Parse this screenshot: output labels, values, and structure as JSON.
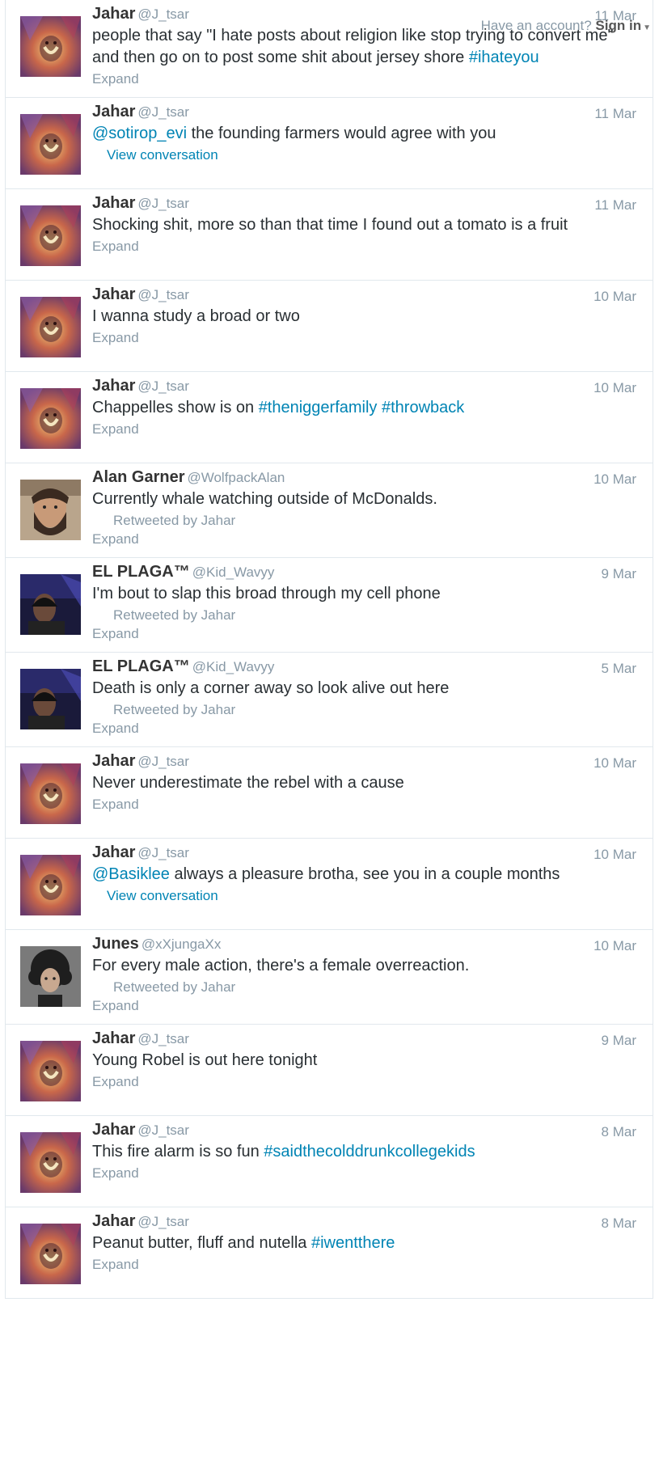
{
  "topbar": {
    "have_account": "Have an account?",
    "sign_in": "Sign in"
  },
  "tweets": [
    {
      "name": "Jahar",
      "handle": "@J_tsar",
      "time": "11 Mar",
      "avatar": "lion-avatar",
      "parts": [
        {
          "t": "people that say \"I hate posts about religion like stop trying to convert me\" and then go on to post some shit about jersey shore "
        },
        {
          "t": "#ihateyou",
          "link": true
        }
      ],
      "retweeted": "",
      "action": "Expand"
    },
    {
      "name": "Jahar",
      "handle": "@J_tsar",
      "time": "11 Mar",
      "avatar": "lion-avatar",
      "parts": [
        {
          "t": "@sotirop_evi",
          "link": true
        },
        {
          "t": " the founding farmers would agree with you"
        }
      ],
      "retweeted": "",
      "action": "View conversation"
    },
    {
      "name": "Jahar",
      "handle": "@J_tsar",
      "time": "11 Mar",
      "avatar": "lion-avatar",
      "parts": [
        {
          "t": "Shocking shit, more so than that time I found out a tomato is a fruit"
        }
      ],
      "retweeted": "",
      "action": "Expand"
    },
    {
      "name": "Jahar",
      "handle": "@J_tsar",
      "time": "10 Mar",
      "avatar": "lion-avatar",
      "parts": [
        {
          "t": "I wanna study a broad or two"
        }
      ],
      "retweeted": "",
      "action": "Expand"
    },
    {
      "name": "Jahar",
      "handle": "@J_tsar",
      "time": "10 Mar",
      "avatar": "lion-avatar",
      "parts": [
        {
          "t": "Chappelles show is on "
        },
        {
          "t": "#theniggerfamily",
          "link": true
        },
        {
          "t": " "
        },
        {
          "t": "#throwback",
          "link": true
        }
      ],
      "retweeted": "",
      "action": "Expand"
    },
    {
      "name": "Alan Garner",
      "handle": "@WolfpackAlan",
      "time": "10 Mar",
      "avatar": "bearded-man-avatar",
      "parts": [
        {
          "t": "Currently whale watching outside of McDonalds."
        }
      ],
      "retweeted": "Retweeted by Jahar",
      "action": "Expand"
    },
    {
      "name": "EL PLAGA™",
      "handle": "@Kid_Wavyy",
      "time": "9 Mar",
      "avatar": "dark-photo-avatar",
      "parts": [
        {
          "t": "I'm bout to slap this broad through my cell phone"
        }
      ],
      "retweeted": "Retweeted by Jahar",
      "action": "Expand"
    },
    {
      "name": "EL PLAGA™",
      "handle": "@Kid_Wavyy",
      "time": "5 Mar",
      "avatar": "dark-photo-avatar",
      "parts": [
        {
          "t": "Death is only a corner away so look alive out here"
        }
      ],
      "retweeted": "Retweeted by Jahar",
      "action": "Expand"
    },
    {
      "name": "Jahar",
      "handle": "@J_tsar",
      "time": "10 Mar",
      "avatar": "lion-avatar",
      "parts": [
        {
          "t": "Never underestimate the rebel with a cause"
        }
      ],
      "retweeted": "",
      "action": "Expand"
    },
    {
      "name": "Jahar",
      "handle": "@J_tsar",
      "time": "10 Mar",
      "avatar": "lion-avatar",
      "parts": [
        {
          "t": "@Basiklee",
          "link": true
        },
        {
          "t": " always a pleasure brotha, see you in a couple months"
        }
      ],
      "retweeted": "",
      "action": "View conversation"
    },
    {
      "name": "Junes",
      "handle": "@xXjungaXx",
      "time": "10 Mar",
      "avatar": "curly-hair-avatar",
      "parts": [
        {
          "t": "For every male action, there's a female overreaction."
        }
      ],
      "retweeted": "Retweeted by Jahar",
      "action": "Expand"
    },
    {
      "name": "Jahar",
      "handle": "@J_tsar",
      "time": "9 Mar",
      "avatar": "lion-avatar",
      "parts": [
        {
          "t": "Young Robel is out here tonight"
        }
      ],
      "retweeted": "",
      "action": "Expand"
    },
    {
      "name": "Jahar",
      "handle": "@J_tsar",
      "time": "8 Mar",
      "avatar": "lion-avatar",
      "parts": [
        {
          "t": "This fire alarm is so fun "
        },
        {
          "t": "#saidthecolddrunkcollegekids",
          "link": true
        }
      ],
      "retweeted": "",
      "action": "Expand"
    },
    {
      "name": "Jahar",
      "handle": "@J_tsar",
      "time": "8 Mar",
      "avatar": "lion-avatar",
      "parts": [
        {
          "t": "Peanut butter, fluff and nutella "
        },
        {
          "t": "#iwentthere",
          "link": true
        }
      ],
      "retweeted": "",
      "action": "Expand"
    }
  ]
}
